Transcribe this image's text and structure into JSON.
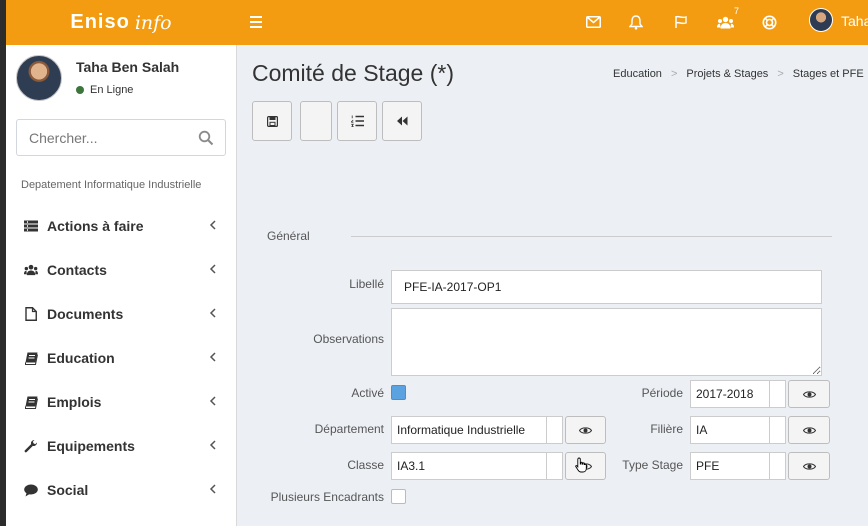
{
  "app": {
    "logo_main": "Eniso",
    "logo_sub": "info"
  },
  "topbar": {
    "user_name": "Taha",
    "notifications_badge": "7",
    "icons": [
      "envelope-icon",
      "bell-icon",
      "flag-icon",
      "users-icon",
      "lifebuoy-icon"
    ]
  },
  "sidebar": {
    "user": {
      "name": "Taha Ben Salah",
      "status": "En Ligne"
    },
    "search": {
      "placeholder": "Chercher..."
    },
    "department": "Depatement Informatique Industrielle",
    "items": [
      {
        "label": "Actions à faire",
        "icon": "list-icon"
      },
      {
        "label": "Contacts",
        "icon": "users-icon"
      },
      {
        "label": "Documents",
        "icon": "document-icon"
      },
      {
        "label": "Education",
        "icon": "book-icon"
      },
      {
        "label": "Emplois",
        "icon": "book-icon"
      },
      {
        "label": "Equipements",
        "icon": "wrench-icon"
      },
      {
        "label": "Social",
        "icon": "comment-icon"
      }
    ]
  },
  "page": {
    "title": "Comité de Stage (*)",
    "breadcrumb": [
      "Education",
      "Projets & Stages",
      "Stages et PFE"
    ]
  },
  "toolbar": {
    "buttons": [
      "save-icon",
      "blank",
      "ordered-list-icon",
      "fast-backward-icon"
    ]
  },
  "form": {
    "section": "Général",
    "libelle": {
      "label": "Libellé",
      "value": "PFE-IA-2017-OP1"
    },
    "observations": {
      "label": "Observations",
      "value": ""
    },
    "active": {
      "label": "Activé",
      "checked": true
    },
    "periode": {
      "label": "Période",
      "value": "2017-2018"
    },
    "departement": {
      "label": "Département",
      "value": "Informatique Industrielle"
    },
    "filiere": {
      "label": "Filière",
      "value": "IA"
    },
    "classe": {
      "label": "Classe",
      "value": "IA3.1"
    },
    "type_stage": {
      "label": "Type Stage",
      "value": "PFE"
    },
    "plusieurs_encadrants": {
      "label": "Plusieurs Encadrants",
      "checked": false
    }
  },
  "colors": {
    "accent": "#f39c12",
    "status_online": "#3c763d",
    "checkbox_on": "#5ba3e0"
  }
}
